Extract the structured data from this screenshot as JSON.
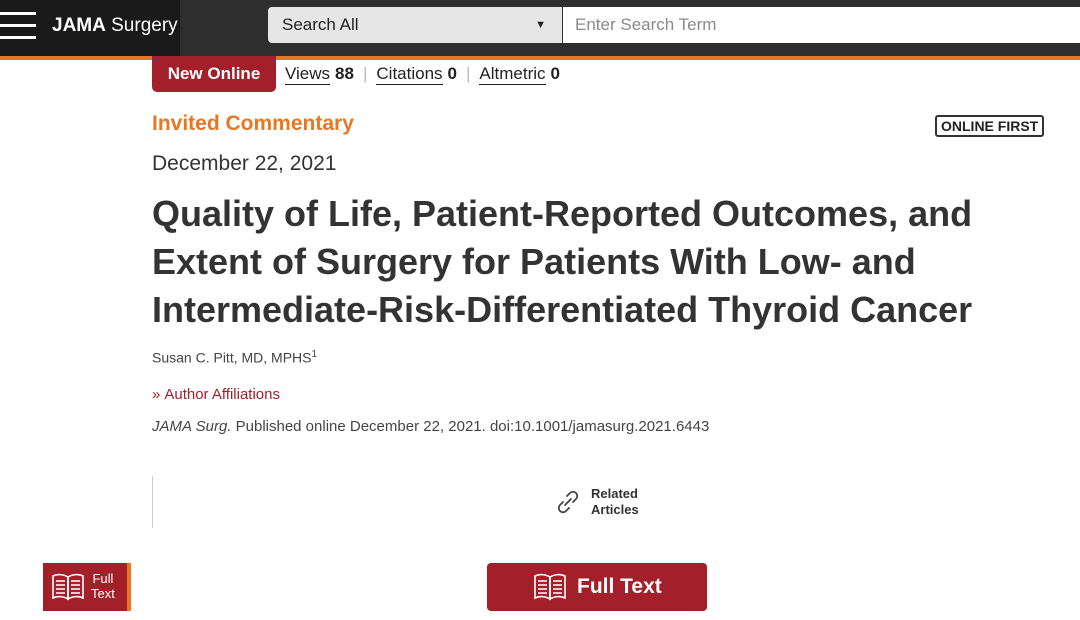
{
  "header": {
    "brand_bold": "JAMA",
    "brand_light": " Surgery",
    "search_scope": "Search All",
    "search_placeholder": "Enter Search Term",
    "accent_color": "#e87722"
  },
  "metrics": {
    "badge": "New Online",
    "items": [
      {
        "label": "Views",
        "value": "88"
      },
      {
        "label": "Citations",
        "value": "0"
      },
      {
        "label": "Altmetric",
        "value": "0"
      }
    ]
  },
  "article": {
    "category": "Invited Commentary",
    "status_badge": "ONLINE FIRST",
    "date": "December 22, 2021",
    "title": "Quality of Life, Patient-Reported Outcomes, and Extent of Surgery for Patients With Low- and Intermediate-Risk-Differentiated Thyroid Cancer",
    "author": "Susan C. Pitt, MD, MPHS",
    "author_sup": "1",
    "affiliations_label": "Author Affiliations",
    "journal_abbrev": "JAMA Surg.",
    "citation_rest": " Published online December 22, 2021. doi:10.1001/jamasurg.2021.6443"
  },
  "actions": {
    "related_line1": "Related",
    "related_line2": "Articles",
    "side_full_line1": "Full",
    "side_full_line2": "Text",
    "full_text_label": "Full Text"
  },
  "colors": {
    "brand_red": "#a31f2a",
    "orange": "#e87722",
    "dark_bar": "#1a1a1a"
  },
  "icons": [
    "menu-icon",
    "dropdown-caret-icon",
    "chevron-right-icon",
    "link-icon",
    "open-book-icon"
  ]
}
